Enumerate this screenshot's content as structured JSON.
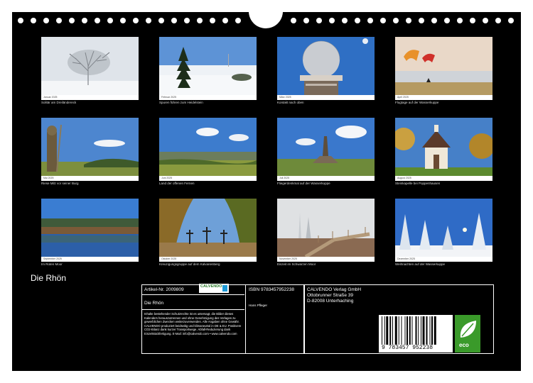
{
  "cover_title": "Die Rhön",
  "months": [
    {
      "name": "Januar 2025",
      "caption": "Solitär am Dreiländereck"
    },
    {
      "name": "Februar 2025",
      "caption": "Spuren führen zum Heidelstein"
    },
    {
      "name": "März 2025",
      "caption": "Kontakt nach oben"
    },
    {
      "name": "April 2025",
      "caption": "Flugtage auf der Wasserkuppe"
    },
    {
      "name": "Mai 2025",
      "caption": "Riese Milz vor seiner Burg"
    },
    {
      "name": "Juni 2025",
      "caption": "Land der offenen Fernen"
    },
    {
      "name": "Juli 2025",
      "caption": "Fliegerdenkmal auf der Wasserkuppe"
    },
    {
      "name": "August 2025",
      "caption": "Steinkapelle bei Poppenhausen"
    },
    {
      "name": "September 2025",
      "caption": "Im Roten Moor"
    },
    {
      "name": "Oktober 2025",
      "caption": "Kreuzigungsgruppe auf dem Kalvarienberg"
    },
    {
      "name": "November 2025",
      "caption": "Eiszeit im Schwarzen Moor"
    },
    {
      "name": "Dezember 2025",
      "caption": "Weihnachten auf der Wasserkuppe"
    }
  ],
  "info": {
    "article": "Artikel-Nr. 2009809",
    "logo": "CALVENDO",
    "product_title": "Die Rhön",
    "description": "Inhalte bestehender Schutzrechte ist es untersagt, die Bilder dieses Kalenders herauszutrennen und ohne Genehmigung des Verlages zu gewerblichen Zwecken weiterzuverwenden. Alle Angaben ohne Gewähr. CALVENDO produziert beidseitig und klimaneutral in DE & EU. Positivere CO2-Bilanz dank kurzer Transportwege. Abfall-Reduzierung dank Einzelstückfertigung. E-Mail: info@calvendo.com • www.calvendo.com",
    "isbn": "ISBN 9783457952238",
    "author": "Hans Pfleger",
    "publisher_lines": [
      "CALVENDO Verlag GmbH",
      "Ottobrunner Straße 39",
      "D-82008 Unterhaching"
    ],
    "barcode_number": "9 783457 952238",
    "eco_label": "eco"
  }
}
